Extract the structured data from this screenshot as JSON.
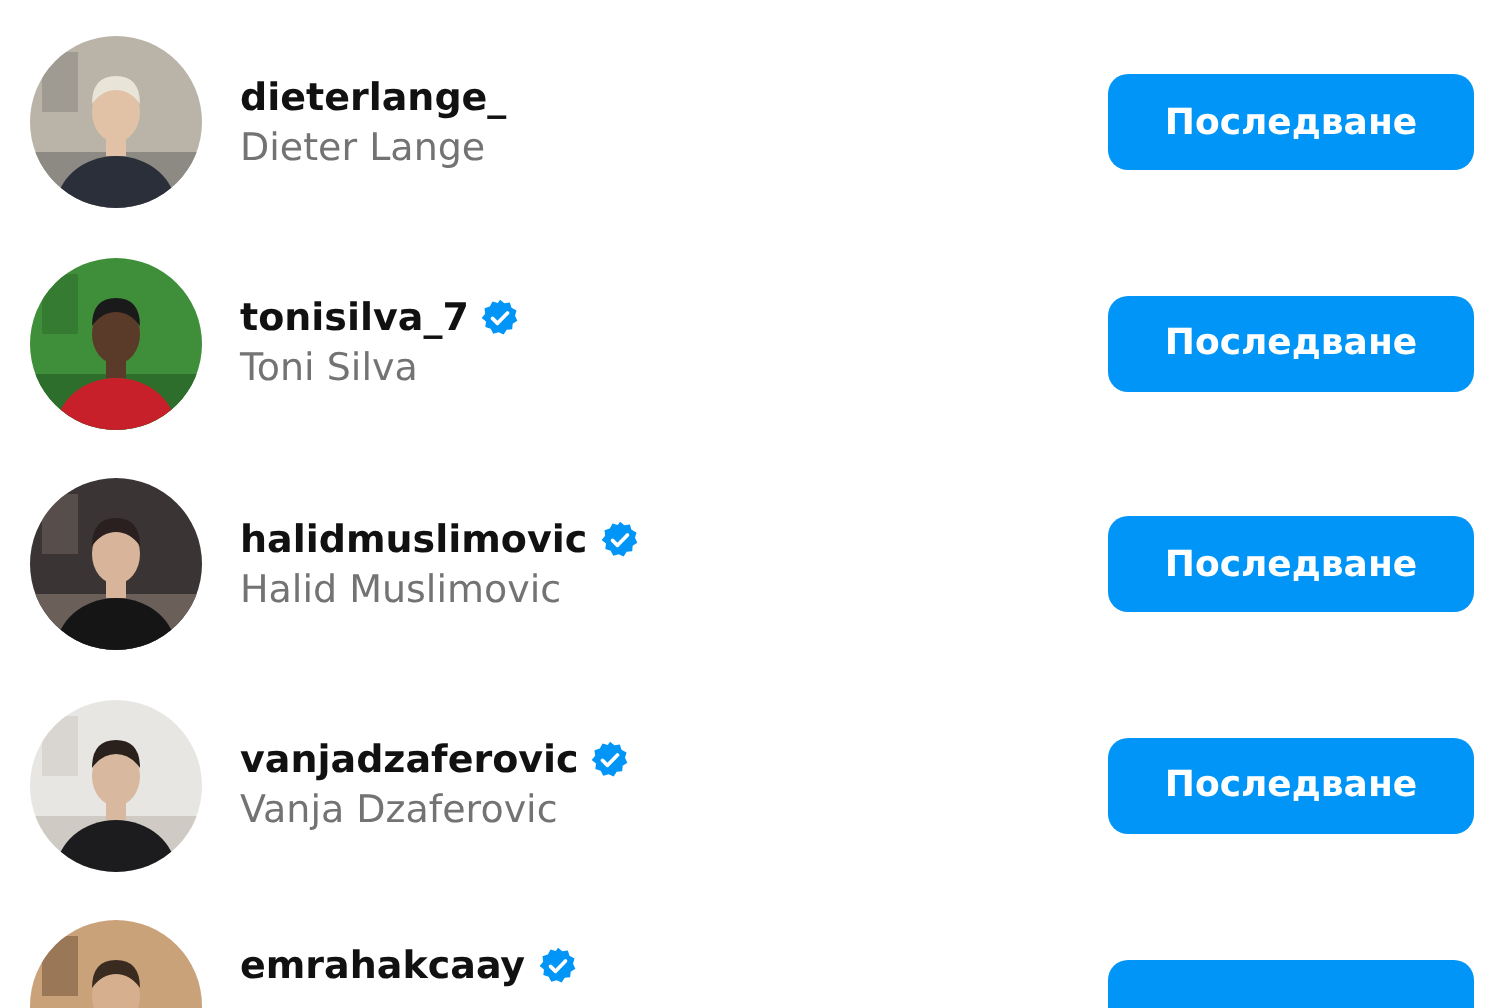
{
  "accounts": [
    {
      "username": "dieterlange_",
      "verified": false,
      "name": "Dieter Lange",
      "button": "Последване"
    },
    {
      "username": "tonisilva_7",
      "verified": true,
      "name": "Toni Silva",
      "button": "Последване"
    },
    {
      "username": "halidmuslimovic",
      "verified": true,
      "name": "Halid Muslimovic",
      "button": "Последване"
    },
    {
      "username": "vanjadzaferovic",
      "verified": true,
      "name": "Vanja Dzaferovic",
      "button": "Последване"
    },
    {
      "username": "emrahakcaay",
      "verified": true
    }
  ]
}
